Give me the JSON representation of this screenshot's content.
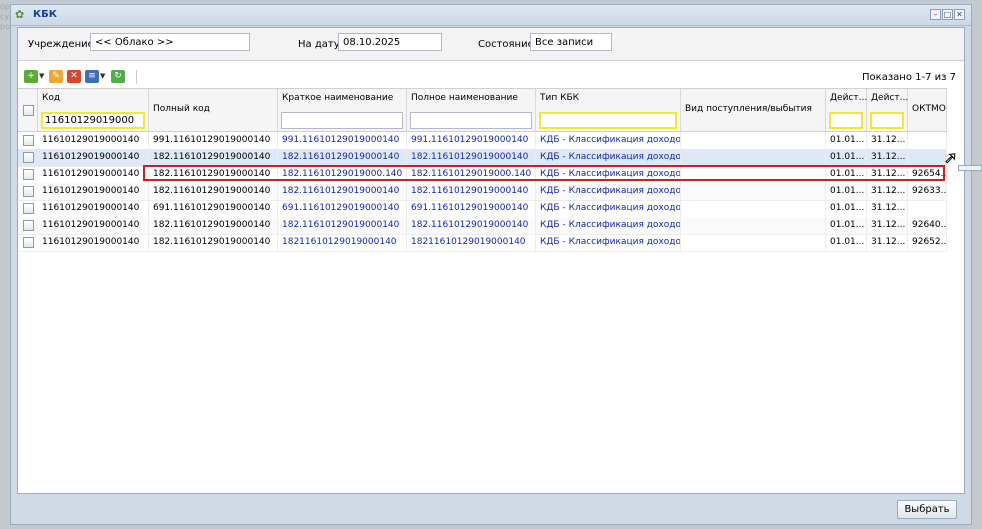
{
  "background_text": [
    "ора",
    "сус",
    "рос"
  ],
  "window": {
    "title": "КБК",
    "buttons": [
      "minimize",
      "maximize",
      "close"
    ]
  },
  "filters": {
    "institution_label": "Учреждение:",
    "institution_value": "<< Облако >>",
    "date_label": "На дату:",
    "date_value": "08.10.2025",
    "state_label": "Состояние:",
    "state_value": "Все записи"
  },
  "toolbar": {
    "icons": [
      "add-icon",
      "edit-icon",
      "delete-icon",
      "list-icon",
      "refresh-icon"
    ],
    "shown_text": "Показано 1-7 из 7"
  },
  "grid": {
    "columns": [
      {
        "label": "Код",
        "filter": "11610129019000"
      },
      {
        "label": "Полный код",
        "filter": null
      },
      {
        "label": "Краткое наименование",
        "filter": ""
      },
      {
        "label": "Полное наименование",
        "filter": ""
      },
      {
        "label": "Тип КБК",
        "filter": ""
      },
      {
        "label": "Вид поступления/выбытия",
        "filter": null
      },
      {
        "label": "Дейст...",
        "filter": ""
      },
      {
        "label": "Дейст...",
        "filter": ""
      },
      {
        "label": "ОКТМО",
        "filter": null
      }
    ],
    "selected_row": 1,
    "rows": [
      [
        "11610129019000140",
        "991.11610129019000140",
        "991.11610129019000140",
        "991.11610129019000140",
        "КДБ - Классификация доходов",
        "",
        "01.01...",
        "31.12...",
        ""
      ],
      [
        "11610129019000140",
        "182.11610129019000140",
        "182.11610129019000140",
        "182.11610129019000140",
        "КДБ - Классификация доходов",
        "",
        "01.01...",
        "31.12...",
        ""
      ],
      [
        "11610129019000140",
        "182.11610129019000140",
        "182.11610129019000.140",
        "182.11610129019000.140",
        "КДБ - Классификация доходов",
        "",
        "01.01...",
        "31.12...",
        "92654..."
      ],
      [
        "11610129019000140",
        "182.11610129019000140",
        "182.11610129019000140",
        "182.11610129019000140",
        "КДБ - Классификация доходов",
        "",
        "01.01...",
        "31.12...",
        "92633..."
      ],
      [
        "11610129019000140",
        "691.11610129019000140",
        "691.11610129019000140",
        "691.11610129019000140",
        "КДБ - Классификация доходов",
        "",
        "01.01...",
        "31.12...",
        ""
      ],
      [
        "11610129019000140",
        "182.11610129019000140",
        "182.11610129019000140",
        "182.11610129019000140",
        "КДБ - Классификация доходов",
        "",
        "01.01...",
        "31.12...",
        "92640..."
      ],
      [
        "11610129019000140",
        "182.11610129019000140",
        "18211610129019000140",
        "18211610129019000140",
        "КДБ - Классификация доходов",
        "",
        "01.01...",
        "31.12...",
        "92652..."
      ]
    ]
  },
  "footer": {
    "select_label": "Выбрать"
  }
}
